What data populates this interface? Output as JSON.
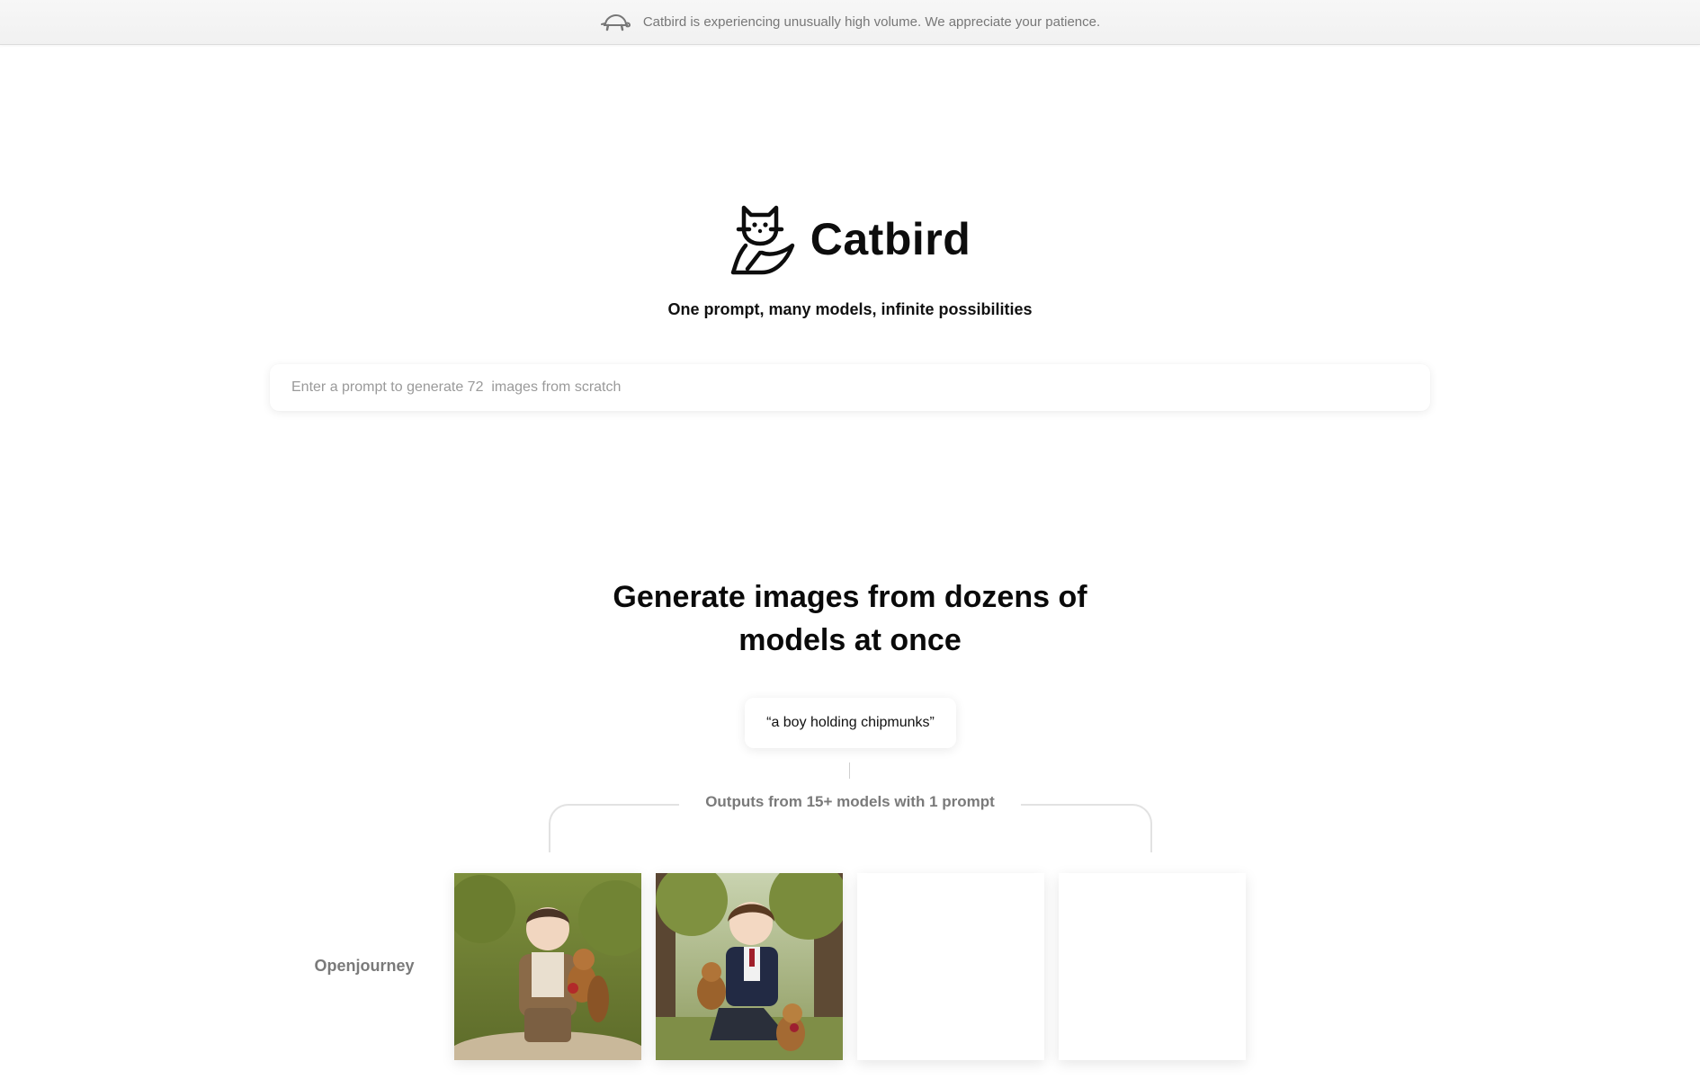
{
  "banner": {
    "icon": "turtle-icon",
    "text": "Catbird is experiencing unusually high volume. We appreciate your patience."
  },
  "brand": {
    "logo_icon": "cat-bird-logo-icon",
    "name": "Catbird",
    "tagline": "One prompt, many models, infinite possibilities"
  },
  "prompt": {
    "placeholder": "Enter a prompt to generate 72  images from scratch",
    "value": ""
  },
  "showcase": {
    "title_line1": "Generate images from dozens of",
    "title_line2": "models at once",
    "example_prompt": "“a boy holding chipmunks”",
    "outputs_label": "Outputs from 15+ models with 1 prompt",
    "rows": [
      {
        "model": "Openjourney",
        "images": [
          {
            "state": "loaded",
            "description": "boy-with-chipmunk-park"
          },
          {
            "state": "loaded",
            "description": "boy-in-suit-with-chipmunks"
          },
          {
            "state": "empty"
          },
          {
            "state": "empty"
          }
        ]
      }
    ]
  }
}
